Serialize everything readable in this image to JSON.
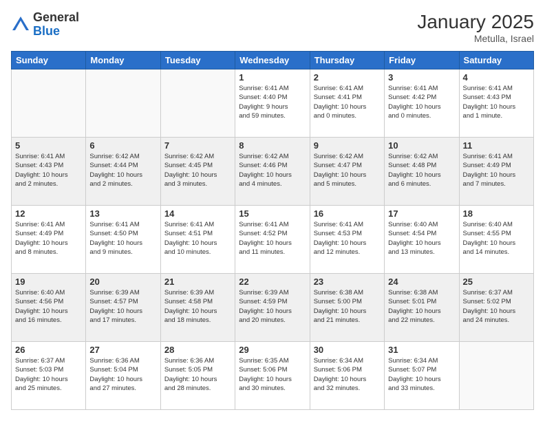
{
  "header": {
    "logo_general": "General",
    "logo_blue": "Blue",
    "title": "January 2025",
    "location": "Metulla, Israel"
  },
  "weekdays": [
    "Sunday",
    "Monday",
    "Tuesday",
    "Wednesday",
    "Thursday",
    "Friday",
    "Saturday"
  ],
  "rows": [
    {
      "shaded": false,
      "cells": [
        {
          "day": "",
          "info": ""
        },
        {
          "day": "",
          "info": ""
        },
        {
          "day": "",
          "info": ""
        },
        {
          "day": "1",
          "info": "Sunrise: 6:41 AM\nSunset: 4:40 PM\nDaylight: 9 hours\nand 59 minutes."
        },
        {
          "day": "2",
          "info": "Sunrise: 6:41 AM\nSunset: 4:41 PM\nDaylight: 10 hours\nand 0 minutes."
        },
        {
          "day": "3",
          "info": "Sunrise: 6:41 AM\nSunset: 4:42 PM\nDaylight: 10 hours\nand 0 minutes."
        },
        {
          "day": "4",
          "info": "Sunrise: 6:41 AM\nSunset: 4:43 PM\nDaylight: 10 hours\nand 1 minute."
        }
      ]
    },
    {
      "shaded": true,
      "cells": [
        {
          "day": "5",
          "info": "Sunrise: 6:41 AM\nSunset: 4:43 PM\nDaylight: 10 hours\nand 2 minutes."
        },
        {
          "day": "6",
          "info": "Sunrise: 6:42 AM\nSunset: 4:44 PM\nDaylight: 10 hours\nand 2 minutes."
        },
        {
          "day": "7",
          "info": "Sunrise: 6:42 AM\nSunset: 4:45 PM\nDaylight: 10 hours\nand 3 minutes."
        },
        {
          "day": "8",
          "info": "Sunrise: 6:42 AM\nSunset: 4:46 PM\nDaylight: 10 hours\nand 4 minutes."
        },
        {
          "day": "9",
          "info": "Sunrise: 6:42 AM\nSunset: 4:47 PM\nDaylight: 10 hours\nand 5 minutes."
        },
        {
          "day": "10",
          "info": "Sunrise: 6:42 AM\nSunset: 4:48 PM\nDaylight: 10 hours\nand 6 minutes."
        },
        {
          "day": "11",
          "info": "Sunrise: 6:41 AM\nSunset: 4:49 PM\nDaylight: 10 hours\nand 7 minutes."
        }
      ]
    },
    {
      "shaded": false,
      "cells": [
        {
          "day": "12",
          "info": "Sunrise: 6:41 AM\nSunset: 4:49 PM\nDaylight: 10 hours\nand 8 minutes."
        },
        {
          "day": "13",
          "info": "Sunrise: 6:41 AM\nSunset: 4:50 PM\nDaylight: 10 hours\nand 9 minutes."
        },
        {
          "day": "14",
          "info": "Sunrise: 6:41 AM\nSunset: 4:51 PM\nDaylight: 10 hours\nand 10 minutes."
        },
        {
          "day": "15",
          "info": "Sunrise: 6:41 AM\nSunset: 4:52 PM\nDaylight: 10 hours\nand 11 minutes."
        },
        {
          "day": "16",
          "info": "Sunrise: 6:41 AM\nSunset: 4:53 PM\nDaylight: 10 hours\nand 12 minutes."
        },
        {
          "day": "17",
          "info": "Sunrise: 6:40 AM\nSunset: 4:54 PM\nDaylight: 10 hours\nand 13 minutes."
        },
        {
          "day": "18",
          "info": "Sunrise: 6:40 AM\nSunset: 4:55 PM\nDaylight: 10 hours\nand 14 minutes."
        }
      ]
    },
    {
      "shaded": true,
      "cells": [
        {
          "day": "19",
          "info": "Sunrise: 6:40 AM\nSunset: 4:56 PM\nDaylight: 10 hours\nand 16 minutes."
        },
        {
          "day": "20",
          "info": "Sunrise: 6:39 AM\nSunset: 4:57 PM\nDaylight: 10 hours\nand 17 minutes."
        },
        {
          "day": "21",
          "info": "Sunrise: 6:39 AM\nSunset: 4:58 PM\nDaylight: 10 hours\nand 18 minutes."
        },
        {
          "day": "22",
          "info": "Sunrise: 6:39 AM\nSunset: 4:59 PM\nDaylight: 10 hours\nand 20 minutes."
        },
        {
          "day": "23",
          "info": "Sunrise: 6:38 AM\nSunset: 5:00 PM\nDaylight: 10 hours\nand 21 minutes."
        },
        {
          "day": "24",
          "info": "Sunrise: 6:38 AM\nSunset: 5:01 PM\nDaylight: 10 hours\nand 22 minutes."
        },
        {
          "day": "25",
          "info": "Sunrise: 6:37 AM\nSunset: 5:02 PM\nDaylight: 10 hours\nand 24 minutes."
        }
      ]
    },
    {
      "shaded": false,
      "cells": [
        {
          "day": "26",
          "info": "Sunrise: 6:37 AM\nSunset: 5:03 PM\nDaylight: 10 hours\nand 25 minutes."
        },
        {
          "day": "27",
          "info": "Sunrise: 6:36 AM\nSunset: 5:04 PM\nDaylight: 10 hours\nand 27 minutes."
        },
        {
          "day": "28",
          "info": "Sunrise: 6:36 AM\nSunset: 5:05 PM\nDaylight: 10 hours\nand 28 minutes."
        },
        {
          "day": "29",
          "info": "Sunrise: 6:35 AM\nSunset: 5:06 PM\nDaylight: 10 hours\nand 30 minutes."
        },
        {
          "day": "30",
          "info": "Sunrise: 6:34 AM\nSunset: 5:06 PM\nDaylight: 10 hours\nand 32 minutes."
        },
        {
          "day": "31",
          "info": "Sunrise: 6:34 AM\nSunset: 5:07 PM\nDaylight: 10 hours\nand 33 minutes."
        },
        {
          "day": "",
          "info": ""
        }
      ]
    }
  ]
}
